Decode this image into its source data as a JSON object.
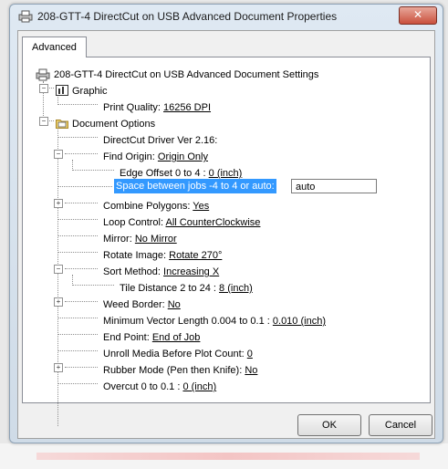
{
  "window": {
    "title": "208-GTT-4 DirectCut on USB Advanced Document Properties",
    "close_glyph": "✕"
  },
  "tab": {
    "label": "Advanced"
  },
  "tree": {
    "root": "208-GTT-4 DirectCut on USB Advanced Document Settings",
    "graphic": "Graphic",
    "print_quality_label": "Print Quality:",
    "print_quality_value": "16256 DPI",
    "document_options": "Document Options",
    "driver_version": "DirectCut Driver Ver 2.16:",
    "find_origin_label": "Find Origin:",
    "find_origin_value": "Origin Only",
    "edge_offset_label": "Edge Offset 0 to 4 :",
    "edge_offset_value": "0  (inch)",
    "space_between_jobs_label": "Space between jobs -4 to 4 or auto:",
    "space_between_jobs_value": "auto",
    "combine_polygons_label": "Combine Polygons:",
    "combine_polygons_value": "Yes",
    "loop_control_label": "Loop Control:",
    "loop_control_value": "All CounterClockwise",
    "mirror_label": "Mirror:",
    "mirror_value": "No Mirror",
    "rotate_label": "Rotate Image:",
    "rotate_value": "Rotate 270°",
    "sort_method_label": "Sort Method:",
    "sort_method_value": "Increasing X",
    "tile_distance_label": "Tile Distance 2 to 24 :",
    "tile_distance_value": "8  (inch)",
    "weed_border_label": "Weed Border:",
    "weed_border_value": "No",
    "min_vector_label": "Minimum Vector Length 0.004 to 0.1 :",
    "min_vector_value": "0.010  (inch)",
    "end_point_label": "End Point:",
    "end_point_value": "End of Job",
    "unroll_label": "Unroll Media Before Plot Count:",
    "unroll_value": "0",
    "rubber_mode_label": "Rubber Mode (Pen then Knife):",
    "rubber_mode_value": "No",
    "overcut_label": "Overcut 0 to 0.1 :",
    "overcut_value": "0  (inch)"
  },
  "buttons": {
    "ok": "OK",
    "cancel": "Cancel"
  },
  "icons": {
    "printer": "printer-icon",
    "graphic": "graphic-icon",
    "folder": "document-options-icon"
  },
  "colors": {
    "selection": "#3399ff"
  }
}
